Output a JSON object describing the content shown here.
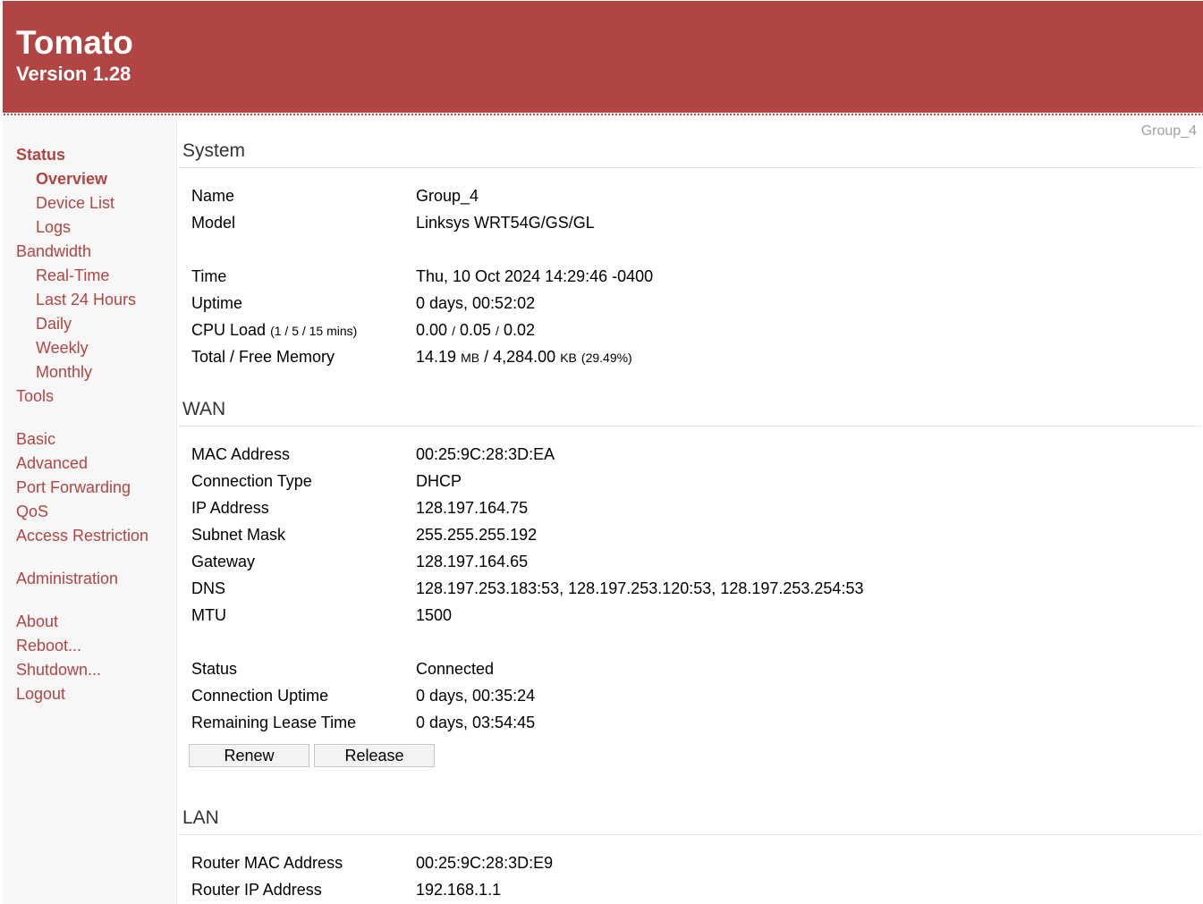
{
  "header": {
    "title": "Tomato",
    "version": "Version 1.28"
  },
  "hostname": "Group_4",
  "nav": {
    "status": "Status",
    "overview": "Overview",
    "device_list": "Device List",
    "logs": "Logs",
    "bandwidth": "Bandwidth",
    "real_time": "Real-Time",
    "last_24_hours": "Last 24 Hours",
    "daily": "Daily",
    "weekly": "Weekly",
    "monthly": "Monthly",
    "tools": "Tools",
    "basic": "Basic",
    "advanced": "Advanced",
    "port_forwarding": "Port Forwarding",
    "qos": "QoS",
    "access_restriction": "Access Restriction",
    "administration": "Administration",
    "about": "About",
    "reboot": "Reboot...",
    "shutdown": "Shutdown...",
    "logout": "Logout"
  },
  "system": {
    "title": "System",
    "name_label": "Name",
    "name_value": "Group_4",
    "model_label": "Model",
    "model_value": "Linksys WRT54G/GS/GL",
    "time_label": "Time",
    "time_value": "Thu, 10 Oct 2024 14:29:46 -0400",
    "uptime_label": "Uptime",
    "uptime_value": "0 days, 00:52:02",
    "cpu_label": "CPU Load",
    "cpu_label_note": "(1 / 5 / 15 mins)",
    "cpu_1": "0.00",
    "cpu_5": "0.05",
    "cpu_15": "0.02",
    "cpu_sep": "/",
    "mem_label": "Total / Free Memory",
    "mem_total": "14.19",
    "mem_total_unit": "MB",
    "mem_sep": "/",
    "mem_free": "4,284.00",
    "mem_free_unit": "KB",
    "mem_pct": "(29.49%)"
  },
  "wan": {
    "title": "WAN",
    "mac_label": "MAC Address",
    "mac_value": "00:25:9C:28:3D:EA",
    "conn_type_label": "Connection Type",
    "conn_type_value": "DHCP",
    "ip_label": "IP Address",
    "ip_value": "128.197.164.75",
    "subnet_label": "Subnet Mask",
    "subnet_value": "255.255.255.192",
    "gateway_label": "Gateway",
    "gateway_value": "128.197.164.65",
    "dns_label": "DNS",
    "dns_value": "128.197.253.183:53, 128.197.253.120:53, 128.197.253.254:53",
    "mtu_label": "MTU",
    "mtu_value": "1500",
    "status_label": "Status",
    "status_value": "Connected",
    "conn_uptime_label": "Connection Uptime",
    "conn_uptime_value": "0 days, 00:35:24",
    "lease_label": "Remaining Lease Time",
    "lease_value": "0 days, 03:54:45",
    "renew_button": "Renew",
    "release_button": "Release"
  },
  "lan": {
    "title": "LAN",
    "router_mac_label": "Router MAC Address",
    "router_mac_value": "00:25:9C:28:3D:E9",
    "router_ip_label": "Router IP Address",
    "router_ip_value": "192.168.1.1"
  },
  "colors": {
    "brand": "#b04543",
    "sidebar_bg": "#f7f7f7"
  }
}
